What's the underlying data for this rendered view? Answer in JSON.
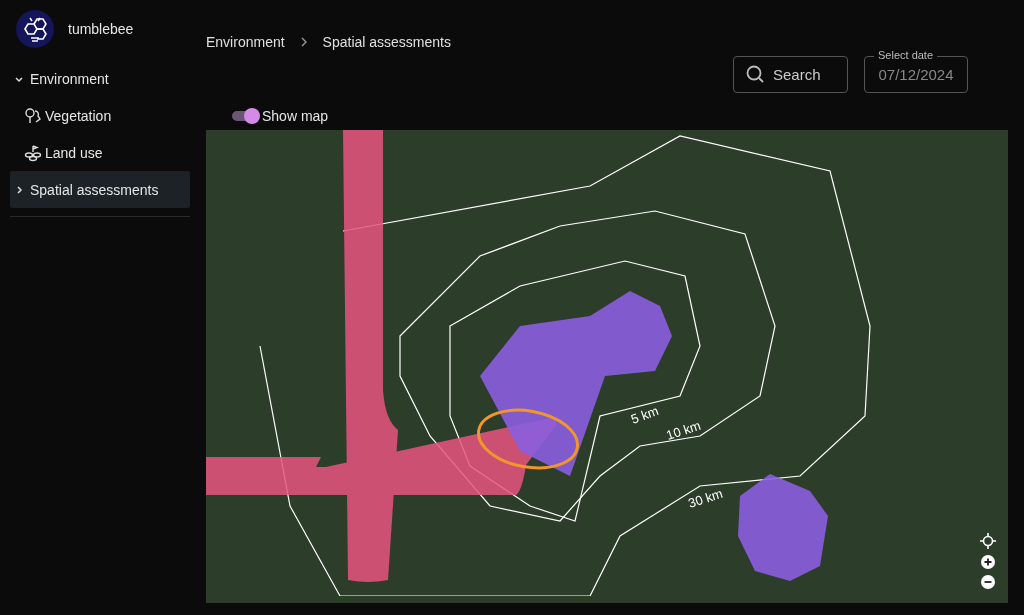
{
  "app": {
    "name": "tumblebee"
  },
  "sidebar": {
    "items": [
      {
        "label": "Environment",
        "expanded": true,
        "selected": false,
        "children": [
          {
            "label": "Vegetation",
            "selected": false
          },
          {
            "label": "Land use",
            "selected": false
          }
        ]
      },
      {
        "label": "Spatial assessments",
        "expanded": false,
        "selected": true
      }
    ]
  },
  "breadcrumb": [
    "Environment",
    "Spatial assessments"
  ],
  "search": {
    "label": "Search"
  },
  "date_field": {
    "label": "Select date",
    "value": "07/12/2024"
  },
  "map_toggle": {
    "label": "Show map",
    "on": true
  },
  "map": {
    "contour_labels": [
      "5 km",
      "10 km",
      "30 km"
    ]
  }
}
